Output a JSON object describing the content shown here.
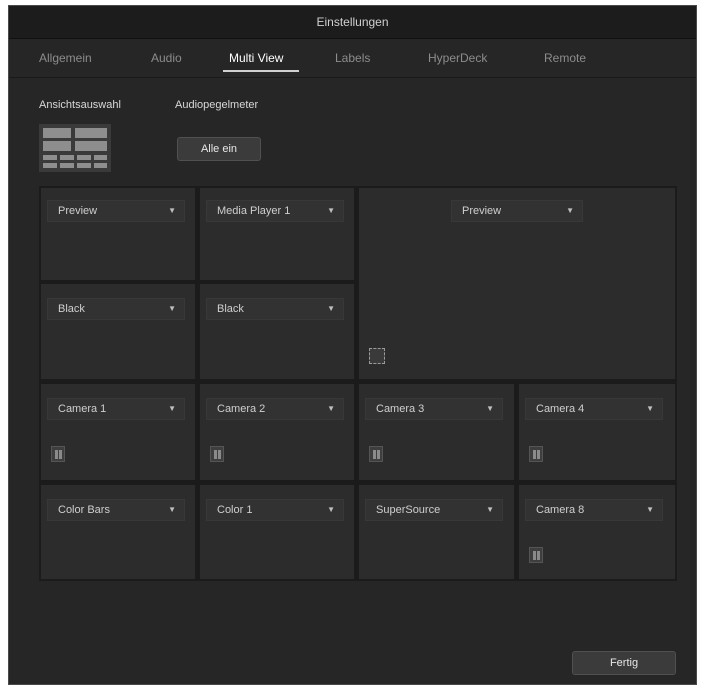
{
  "window": {
    "title": "Einstellungen"
  },
  "tabs": [
    {
      "label": "Allgemein"
    },
    {
      "label": "Audio"
    },
    {
      "label": "Multi View"
    },
    {
      "label": "Labels"
    },
    {
      "label": "HyperDeck"
    },
    {
      "label": "Remote"
    }
  ],
  "active_tab": "Multi View",
  "section": {
    "layout_label": "Ansichtsauswahl",
    "audio_meter_label": "Audiopegelmeter",
    "all_on_button": "Alle ein"
  },
  "sources": {
    "top_left": "Preview",
    "top_mid": "Media Player 1",
    "big": "Preview",
    "mid_left": "Black",
    "mid_mid": "Black",
    "row3": [
      "Camera 1",
      "Camera 2",
      "Camera 3",
      "Camera 4"
    ],
    "row4": [
      "Color Bars",
      "Color 1",
      "SuperSource",
      "Camera 8"
    ]
  },
  "footer": {
    "done_button": "Fertig"
  },
  "icons": {
    "dropdown": "chevron-down-icon",
    "audio_meter": "audio-meter-icon",
    "safe_area": "safe-area-icon",
    "layout": "multiview-layout-icon"
  },
  "colors": {
    "background": "#262626",
    "cell": "#2c2c2c",
    "active_tab": "#ffffff"
  }
}
